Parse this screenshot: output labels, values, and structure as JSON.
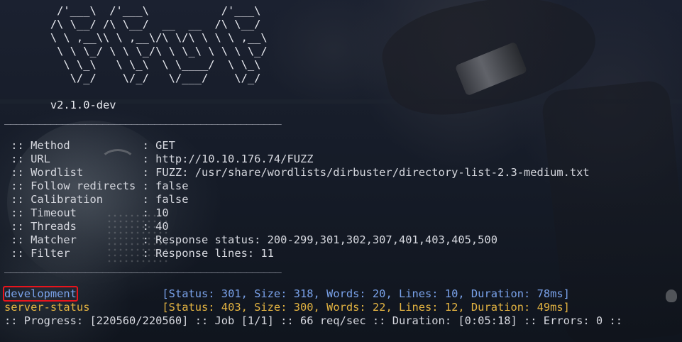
{
  "banner": {
    "lines": [
      "        /'___\\  /'___\\           /'___\\",
      "       /\\ \\__/ /\\ \\__/  __  __  /\\ \\__/",
      "       \\ \\ ,__\\\\ \\ ,__\\/\\ \\/\\ \\ \\ \\ ,__\\",
      "        \\ \\ \\_/ \\ \\ \\_/\\ \\ \\_\\ \\ \\ \\ \\_/",
      "         \\ \\_\\   \\ \\_\\  \\ \\____/  \\ \\_\\",
      "          \\/_/    \\/_/   \\/___/    \\/_/"
    ],
    "version": "       v2.1.0-dev"
  },
  "separator": "________________________________________________",
  "config": [
    {
      "key": " :: Method           ",
      "value": ": GET"
    },
    {
      "key": " :: URL              ",
      "value": ": http://10.10.176.74/FUZZ"
    },
    {
      "key": " :: Wordlist         ",
      "value": ": FUZZ: /usr/share/wordlists/dirbuster/directory-list-2.3-medium.txt"
    },
    {
      "key": " :: Follow redirects ",
      "value": ": false"
    },
    {
      "key": " :: Calibration      ",
      "value": ": false"
    },
    {
      "key": " :: Timeout          ",
      "value": ": 10"
    },
    {
      "key": " :: Threads          ",
      "value": ": 40"
    },
    {
      "key": " :: Matcher          ",
      "value": ": Response status: 200-299,301,302,307,401,403,405,500"
    },
    {
      "key": " :: Filter           ",
      "value": ": Response lines: 11"
    }
  ],
  "results": [
    {
      "name": "development",
      "pad": "             ",
      "info": "[Status: 301, Size: 318, Words: 20, Lines: 10, Duration: 78ms]",
      "color": "#7aa2ea",
      "highlighted": true
    },
    {
      "name": "server-status",
      "pad": "           ",
      "info": "[Status: 403, Size: 300, Words: 22, Lines: 12, Duration: 49ms]",
      "color": "#e3b341",
      "highlighted": false
    }
  ],
  "progress": ":: Progress: [220560/220560] :: Job [1/1] :: 66 req/sec :: Duration: [0:05:18] :: Errors: 0 ::",
  "colors": {
    "background": "#141a24",
    "text": "#d6d8df",
    "result_blue": "#7aa2ea",
    "result_orange": "#e3b341",
    "highlight_box": "#e8141c"
  }
}
